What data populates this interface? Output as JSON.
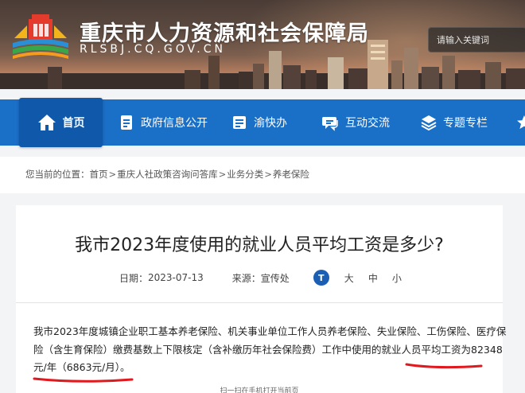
{
  "header": {
    "title": "重庆市人力资源和社会保障局",
    "domain": "RLSBJ.CQ.GOV.CN",
    "search_placeholder": "请输入关键词"
  },
  "nav": {
    "items": [
      {
        "label": "首页",
        "icon": "home-icon"
      },
      {
        "label": "政府信息公开",
        "icon": "document-icon"
      },
      {
        "label": "渝快办",
        "icon": "id-card-icon"
      },
      {
        "label": "互动交流",
        "icon": "chat-icon"
      },
      {
        "label": "专题专栏",
        "icon": "layers-icon"
      },
      {
        "label": "",
        "icon": "star-icon"
      }
    ]
  },
  "breadcrumb": {
    "prefix": "您当前的位置：",
    "items": [
      "首页",
      "重庆人社政策咨询问答库",
      "业务分类",
      "养老保险"
    ],
    "separator": ">"
  },
  "article": {
    "title": "我市2023年度使用的就业人员平均工资是多少?",
    "date_label": "日期：",
    "date_value": "2023-07-13",
    "source_label": "来源：",
    "source_value": "宣传处",
    "font_size_badge": "T",
    "font_sizes": [
      "大",
      "中",
      "小"
    ],
    "body_lines": [
      "我市2023年度城镇企业职工基本养老保险、机关事业单位工作人员养老保险、失业保险、工伤保险、医疗保",
      "险（含生育保险）缴费基数上下限核定（含补缴历年社会保险费）工作中使用的就业人员平均工资为82348",
      "元/年（6863元/月）。"
    ],
    "footer_note": "扫一扫在手机打开当前页"
  },
  "colors": {
    "nav_bg": "#1a6fc7",
    "nav_active_bg": "#0f58aa",
    "annotation_red": "#e0191f",
    "badge_blue": "#1a5fb4"
  }
}
